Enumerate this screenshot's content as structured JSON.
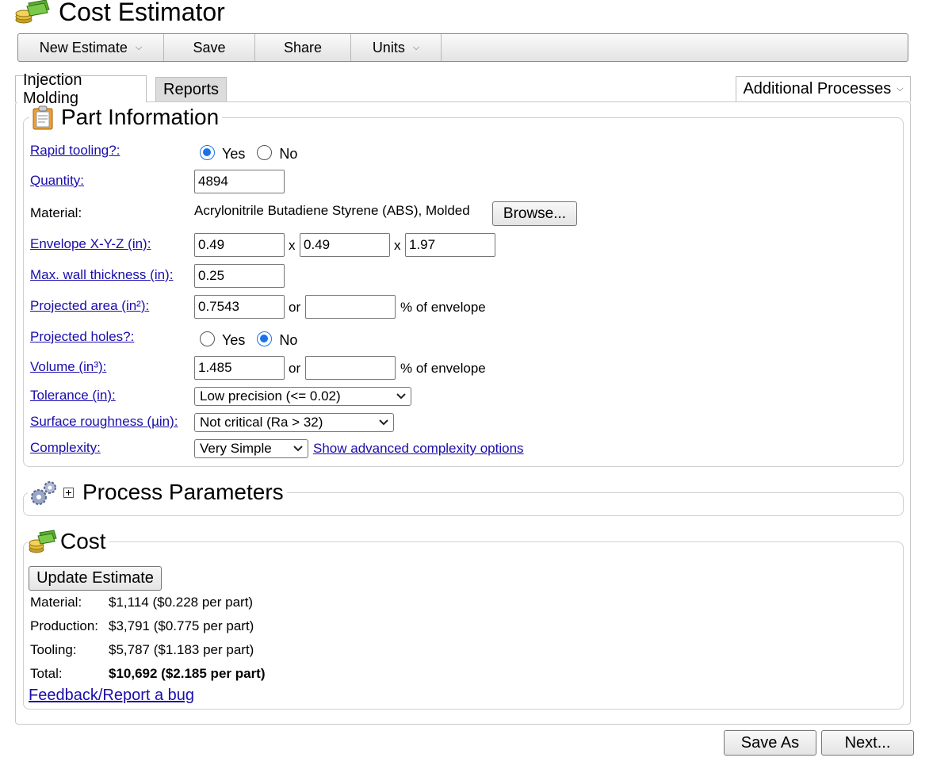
{
  "app": {
    "title": "Cost Estimator"
  },
  "menubar": {
    "items": [
      {
        "label": "New Estimate",
        "has_dropdown": true
      },
      {
        "label": "Save",
        "has_dropdown": false
      },
      {
        "label": "Share",
        "has_dropdown": false
      },
      {
        "label": "Units",
        "has_dropdown": true
      }
    ]
  },
  "tabs": {
    "items": [
      {
        "label": "Injection Molding",
        "active": true
      },
      {
        "label": "Reports",
        "active": false
      }
    ],
    "additional": "Additional Processes"
  },
  "part_info": {
    "title": "Part Information",
    "rapid_tooling": {
      "label": "Rapid tooling?:",
      "yes": "Yes",
      "no": "No",
      "value": "Yes"
    },
    "quantity": {
      "label": "Quantity:",
      "value": "4894"
    },
    "material": {
      "label": "Material:",
      "value": "Acrylonitrile Butadiene Styrene (ABS), Molded",
      "browse": "Browse..."
    },
    "envelope": {
      "label": "Envelope X-Y-Z (in):",
      "x": "0.49",
      "y": "0.49",
      "z": "1.97",
      "sep": "x"
    },
    "wall": {
      "label": "Max. wall thickness (in):",
      "value": "0.25"
    },
    "projected_area": {
      "label": "Projected area (in²):",
      "value": "0.7543",
      "or": "or",
      "pct_value": "",
      "suffix": "% of envelope"
    },
    "projected_holes": {
      "label": "Projected holes?:",
      "yes": "Yes",
      "no": "No",
      "value": "No"
    },
    "volume": {
      "label": "Volume (in³):",
      "value": "1.485",
      "or": "or",
      "pct_value": "",
      "suffix": "% of envelope"
    },
    "tolerance": {
      "label": "Tolerance (in):",
      "value": "Low precision (<= 0.02)"
    },
    "roughness": {
      "label": "Surface roughness (µin):",
      "value": "Not critical (Ra > 32)"
    },
    "complexity": {
      "label": "Complexity:",
      "value": "Very Simple",
      "advanced_link": "Show advanced complexity options"
    }
  },
  "process": {
    "title": "Process Parameters",
    "expand": "+"
  },
  "cost": {
    "title": "Cost",
    "update_button": "Update Estimate",
    "rows": [
      {
        "label": "Material:",
        "value": "$1,114 ($0.228 per part)"
      },
      {
        "label": "Production:",
        "value": "$3,791 ($0.775 per part)"
      },
      {
        "label": "Tooling:",
        "value": "$5,787 ($1.183 per part)"
      },
      {
        "label": "Total:",
        "value": "$10,692 ($2.185 per part)"
      }
    ],
    "feedback_link": "Feedback/Report a bug"
  },
  "footer": {
    "save_as": "Save As",
    "next": "Next..."
  },
  "icons": {
    "logo": "coins-and-money-icon",
    "part": "clipboard-icon",
    "process": "gears-icon",
    "cost": "coins-and-money-icon",
    "dropdown": "chevron-down-icon"
  },
  "colors": {
    "link": "#1a0dab",
    "radio": "#1a73e8"
  }
}
